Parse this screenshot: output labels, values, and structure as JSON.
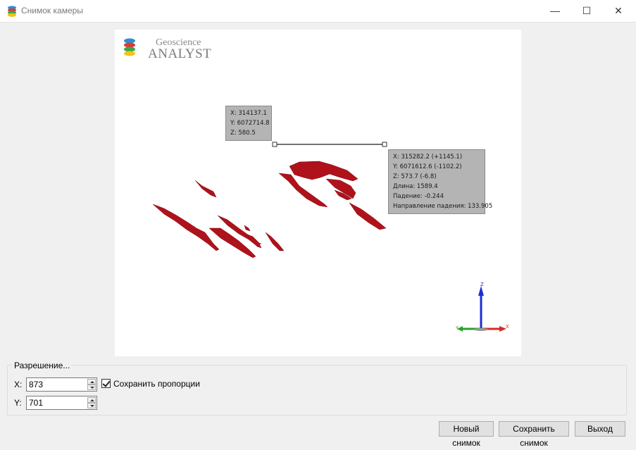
{
  "window": {
    "title": "Снимок камеры",
    "icon": "geoscience-analyst-app-icon",
    "controls": {
      "minimize": "—",
      "maximize": "☐",
      "close": "✕"
    }
  },
  "viewport": {
    "logo": {
      "line1": "Geoscience",
      "line2": "Analyst"
    },
    "point1": {
      "x": "X: 314137.1",
      "y": "Y: 6072714.8",
      "z": "Z: 580.5"
    },
    "point2": {
      "x": "X: 315282.2 (+1145.1)",
      "y": "Y: 6071612.6 (-1102.2)",
      "z": "Z: 573.7 (-6.8)",
      "length": "Длина: 1589.4",
      "dip": "Падение: -0.244",
      "dip_direction": "Направление падения: 133.905"
    },
    "axes": {
      "z": "Z",
      "x": "X",
      "y": "Y"
    }
  },
  "resolution": {
    "group_label": "Разрешение...",
    "x_label": "X:",
    "x_value": "873",
    "y_label": "Y:",
    "y_value": "701",
    "keep_aspect_label": "Сохранить пропорции",
    "keep_aspect_checked": true
  },
  "buttons": {
    "new_snapshot": "Новый снимок",
    "save_snapshot": "Сохранить снимок",
    "exit": "Выход"
  },
  "colors": {
    "geology_body": "#b0121b",
    "tooltip_bg": "#b4b4b4",
    "axis_z": "#1b2fd6",
    "axis_x": "#d52b2b",
    "axis_y": "#2aa02a"
  }
}
